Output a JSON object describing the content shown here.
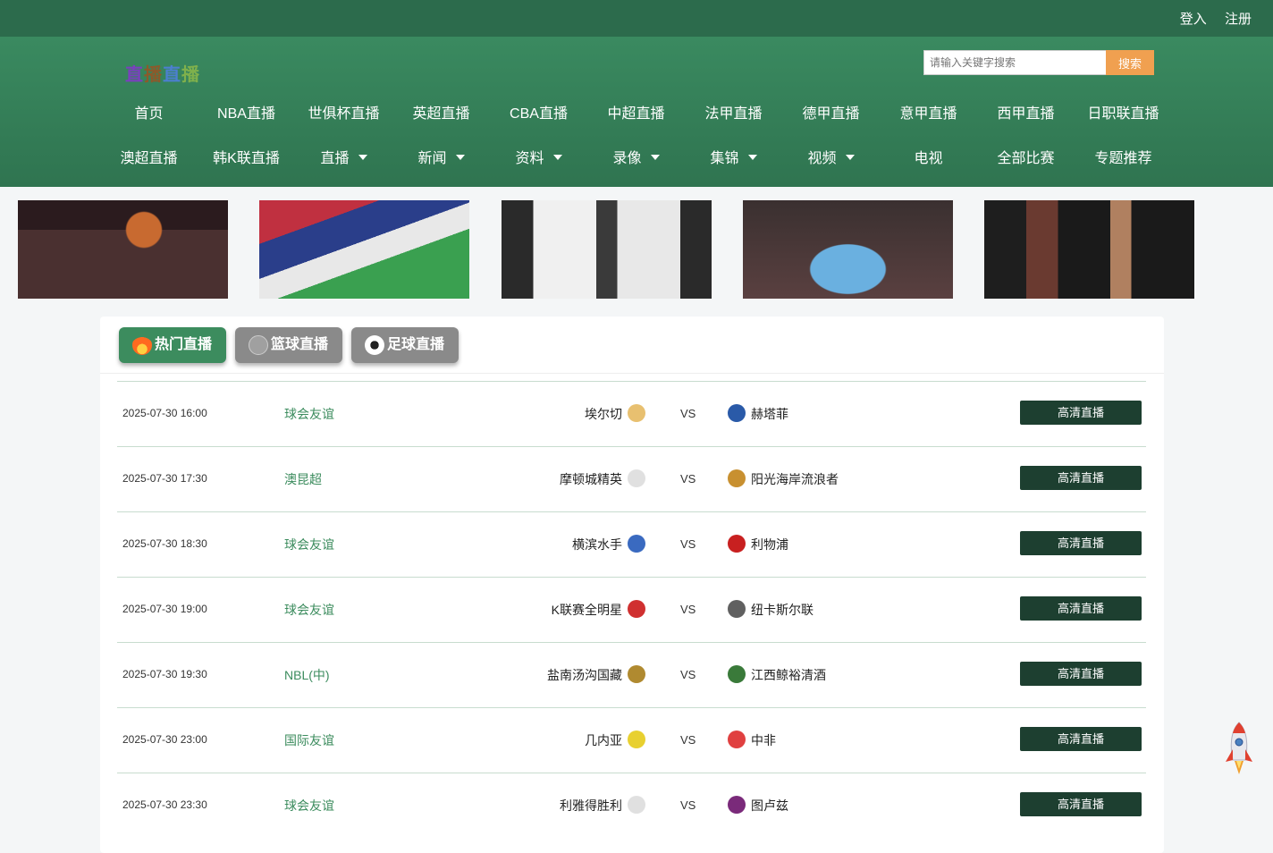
{
  "auth": {
    "login": "登入",
    "register": "注册"
  },
  "logo": {
    "chars": [
      "直",
      "播",
      "直",
      "播"
    ]
  },
  "search": {
    "placeholder": "请输入关键字搜索",
    "button": "搜索"
  },
  "nav": {
    "row1": [
      "首页",
      "NBA直播",
      "世俱杯直播",
      "英超直播",
      "CBA直播",
      "中超直播",
      "法甲直播",
      "德甲直播",
      "意甲直播",
      "西甲直播",
      "日职联直播"
    ],
    "row2": [
      {
        "label": "澳超直播",
        "dropdown": false
      },
      {
        "label": "韩K联直播",
        "dropdown": false
      },
      {
        "label": "直播",
        "dropdown": true
      },
      {
        "label": "新闻",
        "dropdown": true
      },
      {
        "label": "资料",
        "dropdown": true
      },
      {
        "label": "录像",
        "dropdown": true
      },
      {
        "label": "集锦",
        "dropdown": true
      },
      {
        "label": "视频",
        "dropdown": true
      },
      {
        "label": "电视",
        "dropdown": false
      },
      {
        "label": "全部比赛",
        "dropdown": false
      },
      {
        "label": "专题推荐",
        "dropdown": false
      }
    ]
  },
  "tabs": [
    {
      "label": "热门直播",
      "icon": "fire-icon",
      "active": true
    },
    {
      "label": "篮球直播",
      "icon": "basketball-icon",
      "active": false
    },
    {
      "label": "足球直播",
      "icon": "football-icon",
      "active": false
    }
  ],
  "matches": [
    {
      "time": "2025-07-30 16:00",
      "league": "球会友谊",
      "home": "埃尔切",
      "away": "赫塔菲",
      "vs": "VS",
      "button": "高清直播",
      "home_color": "#e8c070",
      "away_color": "#2a5aa8"
    },
    {
      "time": "2025-07-30 17:30",
      "league": "澳昆超",
      "home": "摩顿城精英",
      "away": "阳光海岸流浪者",
      "vs": "VS",
      "button": "高清直播",
      "home_color": "#e0e0e0",
      "away_color": "#c89030"
    },
    {
      "time": "2025-07-30 18:30",
      "league": "球会友谊",
      "home": "横滨水手",
      "away": "利物浦",
      "vs": "VS",
      "button": "高清直播",
      "home_color": "#3a6ac0",
      "away_color": "#c82020"
    },
    {
      "time": "2025-07-30 19:00",
      "league": "球会友谊",
      "home": "K联赛全明星",
      "away": "纽卡斯尔联",
      "vs": "VS",
      "button": "高清直播",
      "home_color": "#d03030",
      "away_color": "#606060"
    },
    {
      "time": "2025-07-30 19:30",
      "league": "NBL(中)",
      "home": "盐南汤沟国藏",
      "away": "江西鲸裕清酒",
      "vs": "VS",
      "button": "高清直播",
      "home_color": "#b08a30",
      "away_color": "#3a7a3a"
    },
    {
      "time": "2025-07-30 23:00",
      "league": "国际友谊",
      "home": "几内亚",
      "away": "中非",
      "vs": "VS",
      "button": "高清直播",
      "home_color": "#e8d030",
      "away_color": "#e04040"
    },
    {
      "time": "2025-07-30 23:30",
      "league": "球会友谊",
      "home": "利雅得胜利",
      "away": "图卢兹",
      "vs": "VS",
      "button": "高清直播",
      "home_color": "#e0e0e0",
      "away_color": "#7a2a7a"
    }
  ]
}
